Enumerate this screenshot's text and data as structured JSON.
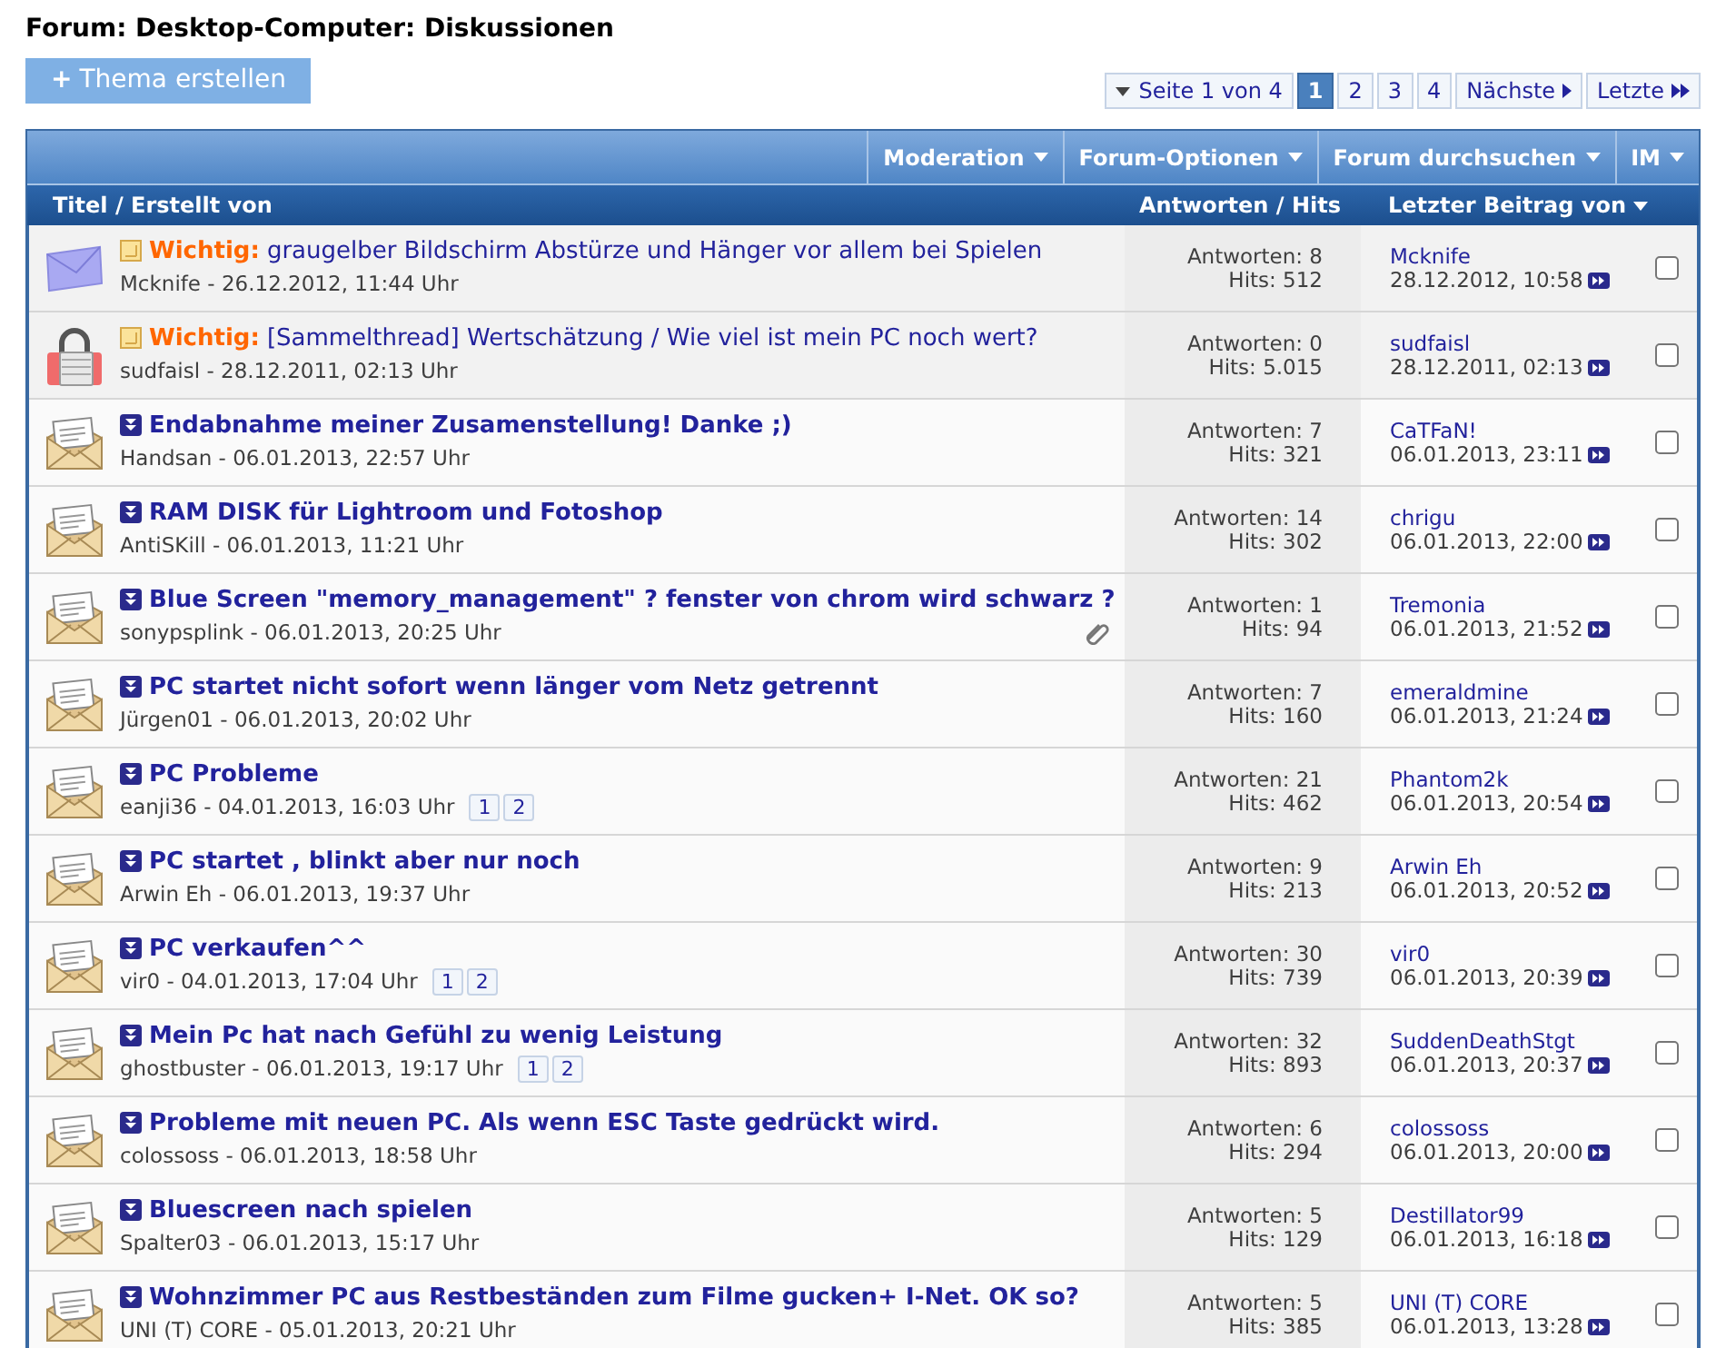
{
  "page_title": "Forum: Desktop-Computer: Diskussionen",
  "new_thread_button": {
    "icon": "+",
    "label": "Thema erstellen"
  },
  "pagination": {
    "summary": "Seite 1 von 4",
    "pages": [
      {
        "label": "1",
        "selected": true
      },
      {
        "label": "2",
        "selected": false
      },
      {
        "label": "3",
        "selected": false
      },
      {
        "label": "4",
        "selected": false
      }
    ],
    "next": "Nächste",
    "last": "Letzte"
  },
  "toolbar": {
    "menus": [
      "Moderation",
      "Forum-Optionen",
      "Forum durchsuchen",
      "IM"
    ]
  },
  "columns": {
    "title": "Titel / Erstellt von",
    "stats": "Antworten / Hits",
    "last_post": "Letzter Beitrag von"
  },
  "threads": [
    {
      "kind": "sticky",
      "prefix": "Wichtig:",
      "title": "graugelber Bildschirm Abstürze und Hänger vor allem bei Spielen",
      "byline": "Mcknife - 26.12.2012, 11:44 Uhr",
      "attachment": false,
      "replies": "Antworten: 8",
      "hits": "Hits: 512",
      "last_user": "Mcknife",
      "last_date": "28.12.2012, 10:58",
      "checked": false
    },
    {
      "kind": "locked_sticky",
      "prefix": "Wichtig:",
      "title": "[Sammelthread] Wertschätzung / Wie viel ist mein PC noch wert?",
      "byline": "sudfaisl - 28.12.2011, 02:13 Uhr",
      "attachment": false,
      "replies": "Antworten: 0",
      "hits": "Hits: 5.015",
      "last_user": "sudfaisl",
      "last_date": "28.12.2011, 02:13",
      "checked": false
    },
    {
      "kind": "thread",
      "title": "Endabnahme meiner Zusamenstellung! Danke ;)",
      "byline": "Handsan - 06.01.2013, 22:57 Uhr",
      "attachment": false,
      "replies": "Antworten: 7",
      "hits": "Hits: 321",
      "last_user": "CaTFaN!",
      "last_date": "06.01.2013, 23:11",
      "checked": false
    },
    {
      "kind": "thread",
      "title": "RAM DISK für Lightroom und Fotoshop",
      "byline": "AntiSKill - 06.01.2013, 11:21 Uhr",
      "attachment": false,
      "replies": "Antworten: 14",
      "hits": "Hits: 302",
      "last_user": "chrigu",
      "last_date": "06.01.2013, 22:00",
      "checked": false
    },
    {
      "kind": "thread",
      "title": "Blue Screen \"memory_management\" ? fenster von chrom wird schwarz ?",
      "byline": "sonypsplink - 06.01.2013, 20:25 Uhr",
      "attachment": true,
      "replies": "Antworten: 1",
      "hits": "Hits: 94",
      "last_user": "Tremonia",
      "last_date": "06.01.2013, 21:52",
      "checked": false
    },
    {
      "kind": "thread",
      "title": "PC startet nicht sofort wenn länger vom Netz getrennt",
      "byline": "Jürgen01 - 06.01.2013, 20:02 Uhr",
      "attachment": false,
      "replies": "Antworten: 7",
      "hits": "Hits: 160",
      "last_user": "emeraldmine",
      "last_date": "06.01.2013, 21:24",
      "checked": false
    },
    {
      "kind": "thread",
      "title": "PC Probleme",
      "byline": "eanji36 - 04.01.2013, 16:03 Uhr",
      "pages": [
        "1",
        "2"
      ],
      "attachment": false,
      "replies": "Antworten: 21",
      "hits": "Hits: 462",
      "last_user": "Phantom2k",
      "last_date": "06.01.2013, 20:54",
      "checked": false
    },
    {
      "kind": "thread",
      "title": "PC startet , blinkt aber nur noch",
      "byline": "Arwin Eh - 06.01.2013, 19:37 Uhr",
      "attachment": false,
      "replies": "Antworten: 9",
      "hits": "Hits: 213",
      "last_user": "Arwin Eh",
      "last_date": "06.01.2013, 20:52",
      "checked": false
    },
    {
      "kind": "thread",
      "title": "PC verkaufen^^",
      "byline": "vir0 - 04.01.2013, 17:04 Uhr",
      "pages": [
        "1",
        "2"
      ],
      "attachment": false,
      "replies": "Antworten: 30",
      "hits": "Hits: 739",
      "last_user": "vir0",
      "last_date": "06.01.2013, 20:39",
      "checked": false
    },
    {
      "kind": "thread",
      "title": "Mein Pc hat nach Gefühl zu wenig Leistung",
      "byline": "ghostbuster - 06.01.2013, 19:17 Uhr",
      "pages": [
        "1",
        "2"
      ],
      "attachment": false,
      "replies": "Antworten: 32",
      "hits": "Hits: 893",
      "last_user": "SuddenDeathStgt",
      "last_date": "06.01.2013, 20:37",
      "checked": false
    },
    {
      "kind": "thread",
      "title": "Probleme mit neuen PC. Als wenn ESC Taste gedrückt wird.",
      "byline": "colossoss - 06.01.2013, 18:58 Uhr",
      "attachment": false,
      "replies": "Antworten: 6",
      "hits": "Hits: 294",
      "last_user": "colossoss",
      "last_date": "06.01.2013, 20:00",
      "checked": false
    },
    {
      "kind": "thread",
      "title": "Bluescreen nach spielen",
      "byline": "Spalter03 - 06.01.2013, 15:17 Uhr",
      "attachment": false,
      "replies": "Antworten: 5",
      "hits": "Hits: 129",
      "last_user": "Destillator99",
      "last_date": "06.01.2013, 16:18",
      "checked": false
    },
    {
      "kind": "thread",
      "title": "Wohnzimmer PC aus Restbeständen zum Filme gucken+ I-Net. OK so?",
      "byline": "UNI (T) CORE - 05.01.2013, 20:21 Uhr",
      "attachment": false,
      "replies": "Antworten: 5",
      "hits": "Hits: 385",
      "last_user": "UNI (T) CORE",
      "last_date": "06.01.2013, 13:28",
      "checked": false
    }
  ]
}
